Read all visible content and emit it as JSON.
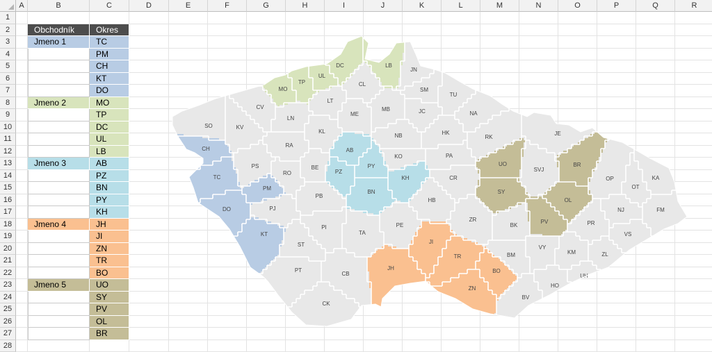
{
  "columns": [
    "A",
    "B",
    "C",
    "D",
    "E",
    "F",
    "G",
    "H",
    "I",
    "J",
    "K",
    "L",
    "M",
    "N",
    "O",
    "P",
    "Q",
    "R"
  ],
  "rows": [
    "1",
    "2",
    "3",
    "4",
    "5",
    "6",
    "7",
    "8",
    "9",
    "10",
    "11",
    "12",
    "13",
    "14",
    "15",
    "16",
    "17",
    "18",
    "19",
    "20",
    "21",
    "22",
    "23",
    "24",
    "25",
    "26",
    "27",
    "28"
  ],
  "table": {
    "header": {
      "dealer": "Obchodník",
      "district": "Okres"
    },
    "groups": [
      {
        "name": "Jmeno 1",
        "color": "#b8cce4",
        "districts": [
          "TC",
          "PM",
          "CH",
          "KT",
          "DO"
        ]
      },
      {
        "name": "Jmeno 2",
        "color": "#d8e4bc",
        "districts": [
          "MO",
          "TP",
          "DC",
          "UL",
          "LB"
        ]
      },
      {
        "name": "Jmeno 3",
        "color": "#b7dee8",
        "districts": [
          "AB",
          "PZ",
          "BN",
          "PY",
          "KH"
        ]
      },
      {
        "name": "Jmeno 4",
        "color": "#fac090",
        "districts": [
          "JH",
          "JI",
          "ZN",
          "TR",
          "BO"
        ]
      },
      {
        "name": "Jmeno 5",
        "color": "#c4bd97",
        "districts": [
          "UO",
          "SY",
          "PV",
          "OL",
          "BR"
        ]
      }
    ]
  },
  "map": {
    "default_color": "#e8e8e8",
    "border_color": "#ffffff",
    "district_labels": [
      "DC",
      "LB",
      "JN",
      "UL",
      "MO",
      "TP",
      "CL",
      "SM",
      "TU",
      "LT",
      "CV",
      "MB",
      "JC",
      "NA",
      "SO",
      "KV",
      "LN",
      "ME",
      "KL",
      "NB",
      "HK",
      "RK",
      "JE",
      "CH",
      "RA",
      "AB",
      "KO",
      "PA",
      "UO",
      "SVJ",
      "BR",
      "PS",
      "BE",
      "PZ",
      "PY",
      "RO",
      "TC",
      "PM",
      "KH",
      "CR",
      "SY",
      "OP",
      "OT",
      "KA",
      "BN",
      "PB",
      "HB",
      "OL",
      "NJ",
      "FM",
      "PJ",
      "DO",
      "PE",
      "ZR",
      "BK",
      "PV",
      "PR",
      "KT",
      "PI",
      "TA",
      "VS",
      "JI",
      "ST",
      "TR",
      "BM",
      "VY",
      "KM",
      "ZL",
      "JH",
      "PT",
      "CB",
      "BO",
      "UH",
      "ZN",
      "HO",
      "CK",
      "BV"
    ]
  }
}
